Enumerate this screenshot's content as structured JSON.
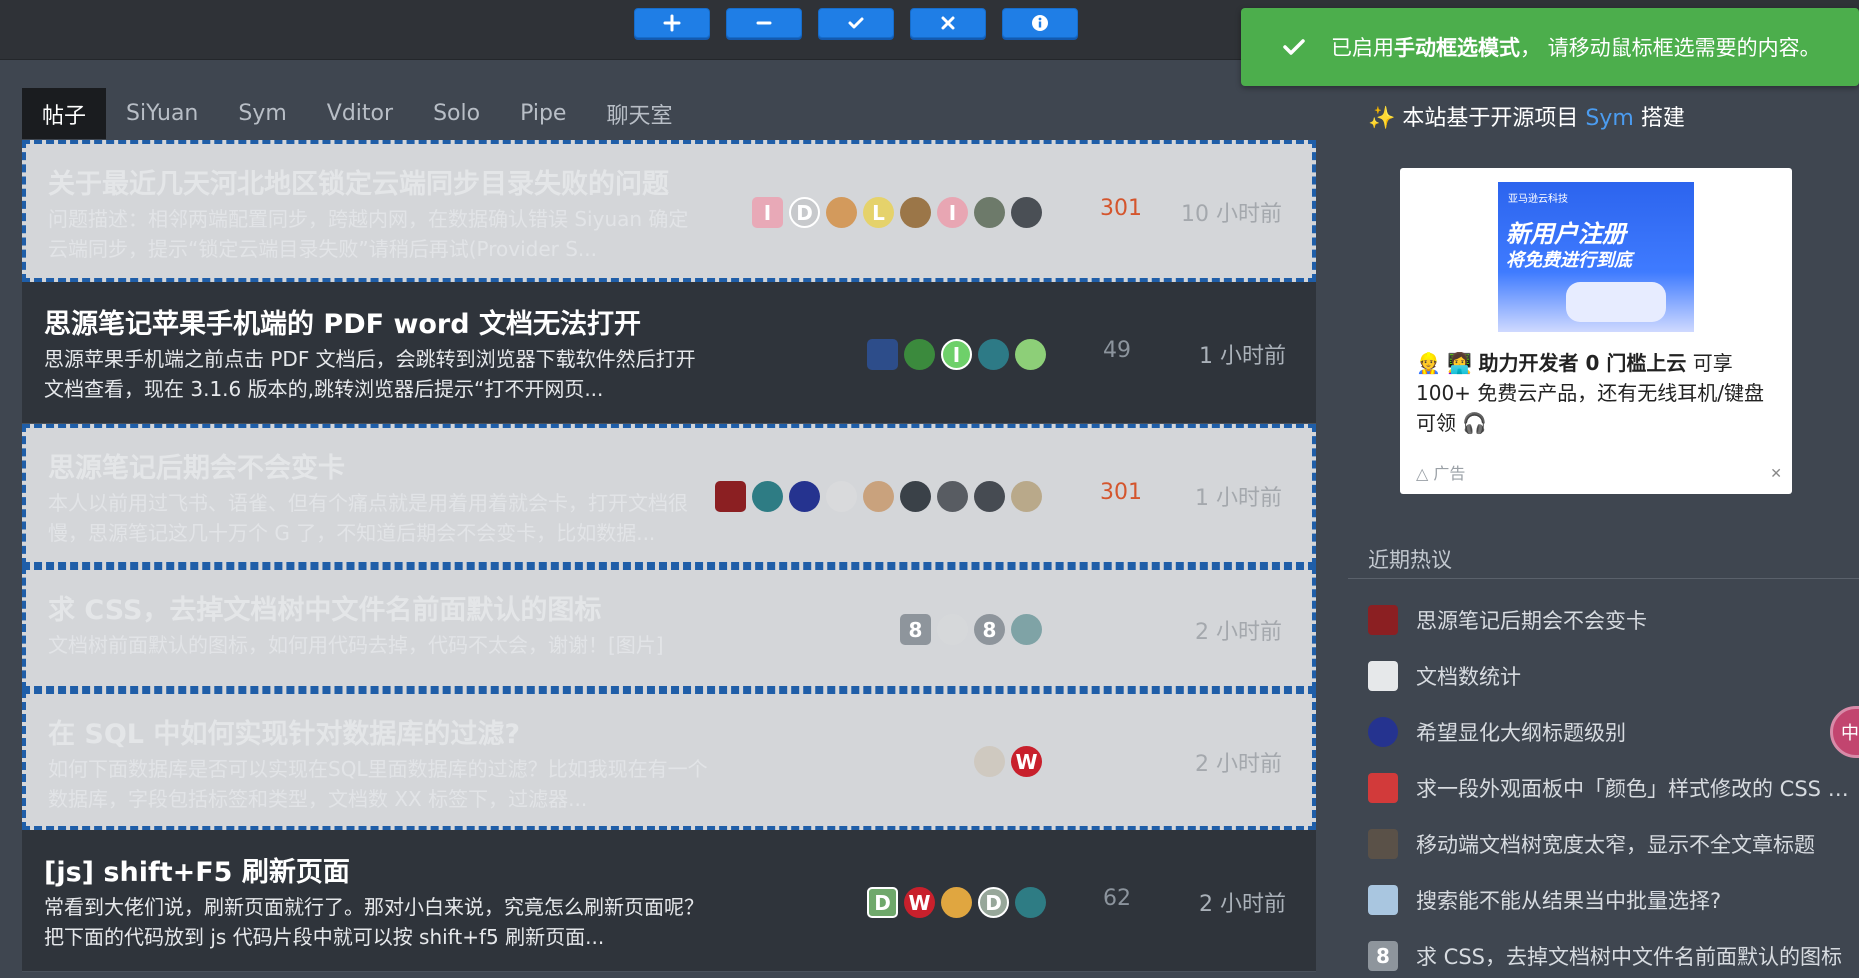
{
  "toolbar": {
    "buttons": [
      {
        "name": "add",
        "icon": "plus-icon"
      },
      {
        "name": "remove",
        "icon": "minus-icon"
      },
      {
        "name": "confirm",
        "icon": "check-icon"
      },
      {
        "name": "cancel",
        "icon": "close-icon"
      },
      {
        "name": "info",
        "icon": "info-icon"
      }
    ],
    "color": "#1f7ee6"
  },
  "toast": {
    "prefix": "已启用 ",
    "mode": "手动框选模式",
    "suffix": "， 请移动鼠标框选需要的内容。",
    "color": "#4cae4c"
  },
  "tabs": [
    "帖子",
    "SiYuan",
    "Sym",
    "Vditor",
    "Solo",
    "Pipe",
    "聊天室"
  ],
  "posts": [
    {
      "title": "关于最近几天河北地区锁定云端同步目录失败的问题",
      "excerpt": "问题描述：相邻两端配置同步，跨越内网，在数据确认错误 Siyuan 确定云端同步，提示“锁定云端目录失败”请稍后再试(Provider S...",
      "count": "301",
      "time": "10 小时前",
      "selected": true
    },
    {
      "title": "思源笔记苹果手机端的 PDF word 文档无法打开",
      "excerpt": "思源苹果手机端之前点击 PDF 文档后，会跳转到浏览器下载软件然后打开文档查看，现在 3.1.6 版本的,跳转浏览器后提示“打不开网页...",
      "count": "49",
      "time": "1 小时前",
      "selected": false
    },
    {
      "title": "思源笔记后期会不会变卡",
      "excerpt": "本人以前用过飞书、语雀、但有个痛点就是用着用着就会卡，打开文档很慢，思源笔记这几十万个 G 了，不知道后期会不会变卡，比如数据...",
      "count": "301",
      "time": "1 小时前",
      "selected": true
    },
    {
      "title": "求 CSS，去掉文档树中文件名前面默认的图标",
      "excerpt": "文档树前面默认的图标，如何用代码去掉，代码不太会，谢谢！[图片]",
      "count": "",
      "time": "2 小时前",
      "selected": true
    },
    {
      "title": "在 SQL 中如何实现针对数据库的过滤?",
      "excerpt": "如何下面数据库是否可以实现在SQL里面数据库的过滤？比如我现在有一个数据库，字段包括标签和类型，文档数 XX 标签下，过滤器...",
      "count": "",
      "time": "2 小时前",
      "selected": true
    },
    {
      "title": "[js] shift+F5 刷新页面",
      "excerpt": "常看到大佬们说，刷新页面就行了。那对小白来说，究竟怎么刷新页面呢？ 把下面的代码放到 js 代码片段中就可以按 shift+f5 刷新页面...",
      "count": "62",
      "time": "2 小时前",
      "selected": false
    }
  ],
  "sidebar": {
    "built_prefix": "本站基于开源项目 ",
    "built_link": "Sym",
    "built_suffix": " 搭建",
    "ad": {
      "banner_small": "亚马逊云科技",
      "banner_line1": "新用户注册",
      "banner_line2": "将免费进行到底",
      "text_emoji": "👷 👩‍💻 ",
      "text_bold": "助力开发者 0 门槛上云",
      "text_rest": " 可享 100+ 免费云产品，还有无线耳机/键盘可领 🎧",
      "label": "△ 广告",
      "close": "✕"
    },
    "hot_title": "近期热议",
    "hot_items": [
      "思源笔记后期会不会变卡",
      "文档数统计",
      "希望显化大纲标题级别",
      "求一段外观面板中「颜色」样式修改的 CSS 代码",
      "移动端文档树宽度太窄，显示不全文章标题",
      "搜索能不能从结果当中批量选择?",
      "求 CSS，去掉文档树中文件名前面默认的图标"
    ],
    "float_tab": "中"
  }
}
